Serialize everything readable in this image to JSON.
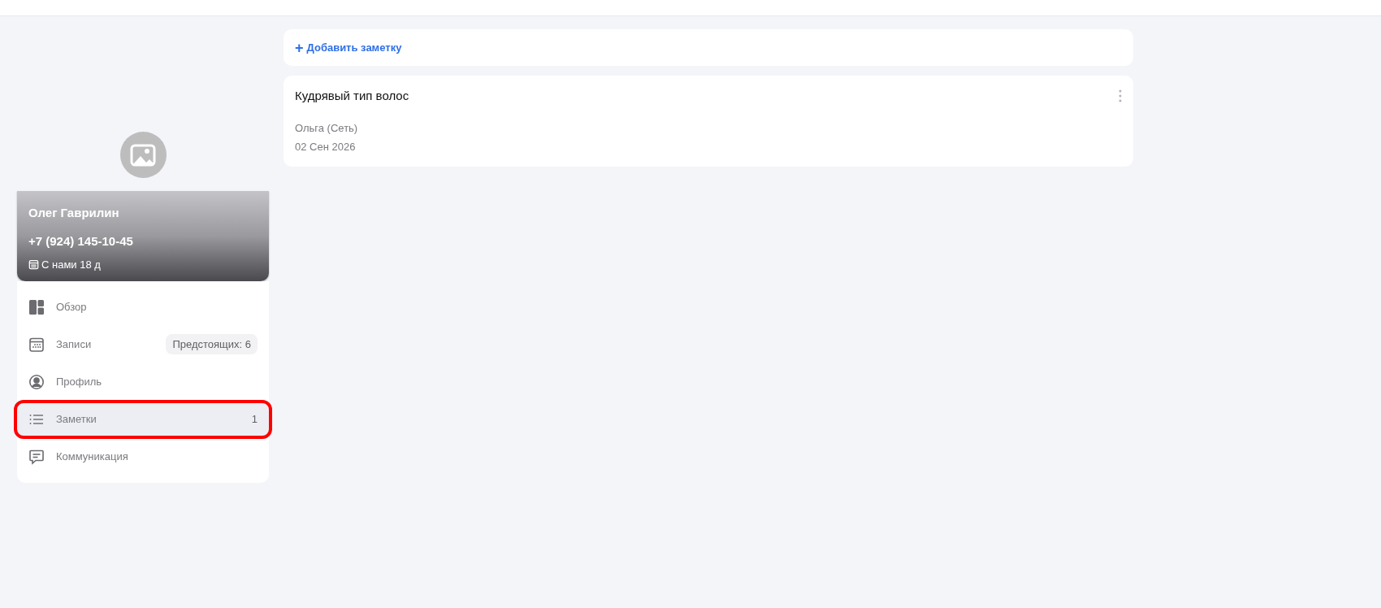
{
  "client": {
    "name": "Олег Гаврилин",
    "phone": "+7 (924) 145-10-45",
    "since": "С нами 18 д"
  },
  "menu": [
    {
      "kind": "overview",
      "label": "Обзор",
      "selected": false,
      "annotated": false
    },
    {
      "kind": "appointments",
      "label": "Записи",
      "badge": "Предстоящих: 6",
      "selected": false,
      "annotated": false
    },
    {
      "kind": "profile",
      "label": "Профиль",
      "selected": false,
      "annotated": false
    },
    {
      "kind": "notes",
      "label": "Заметки",
      "count": "1",
      "selected": true,
      "annotated": true
    },
    {
      "kind": "communication",
      "label": "Коммуникация",
      "selected": false,
      "annotated": false
    }
  ],
  "add_note": {
    "icon": "+",
    "label": "Добавить заметку"
  },
  "notes": [
    {
      "title": "Кудрявый тип волос",
      "author": "Ольга (Сеть)",
      "date": "02 Сен 2026"
    }
  ]
}
